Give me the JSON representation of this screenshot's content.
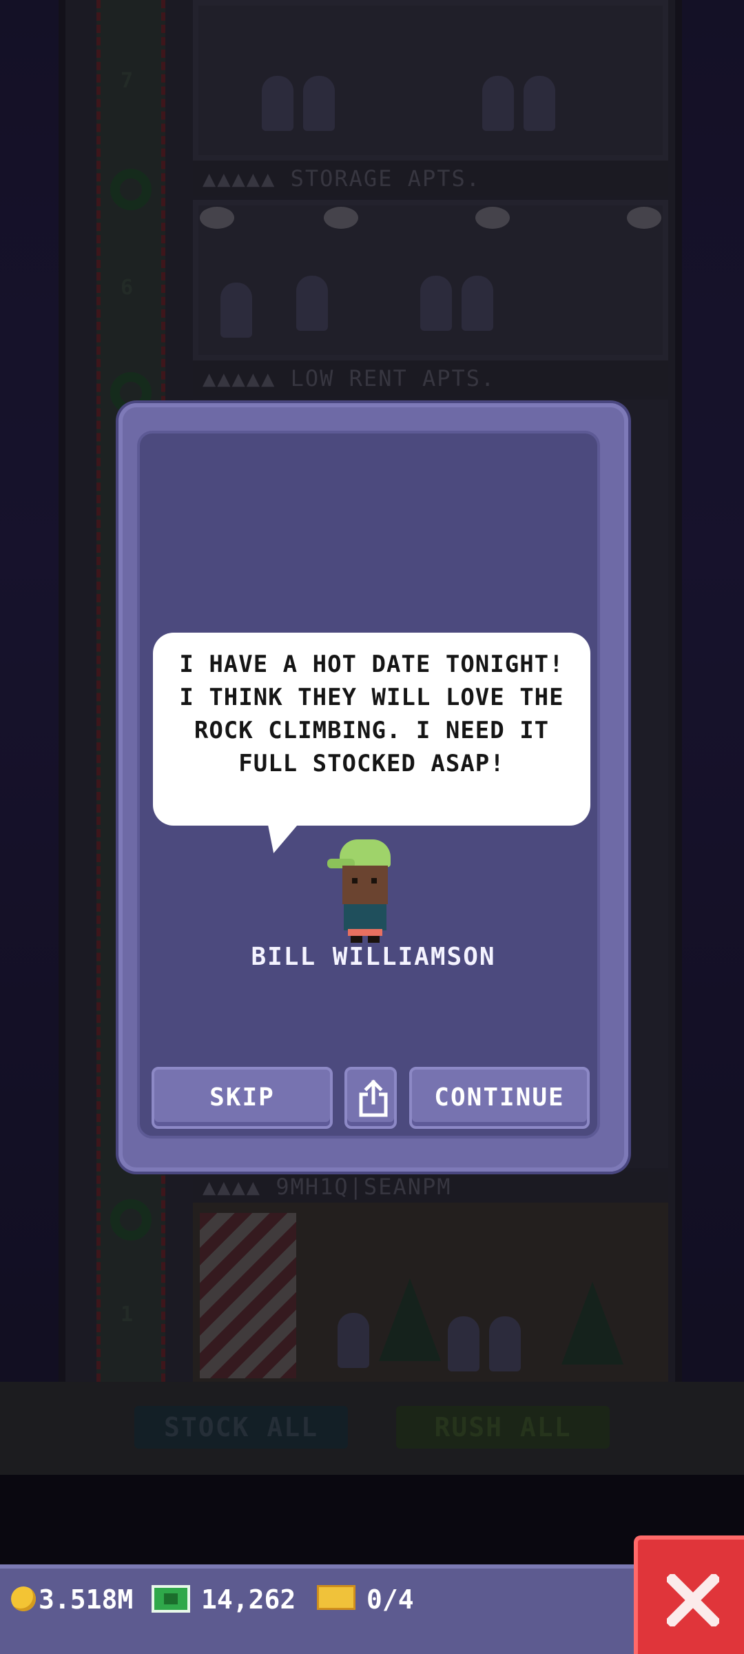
{
  "scene": {
    "floors": [
      {
        "label": "▲▲▲▲▲ STORAGE APTS.",
        "shaft_number": "7"
      },
      {
        "label": "▲▲▲▲▲ LOW RENT APTS.",
        "shaft_number": "6"
      },
      {
        "label": "▲▲▲▲ 9MH1Q|SEANPM",
        "shaft_number": "1"
      }
    ],
    "bottom_buttons": {
      "stock_all": "STOCK ALL",
      "rush_all": "RUSH ALL"
    }
  },
  "dialog": {
    "message": "I HAVE A HOT DATE TONIGHT! I THINK THEY WILL LOVE THE ROCK CLIMBING. I NEED IT FULL STOCKED ASAP!",
    "npc_name": "BILL WILLIAMSON",
    "skip_label": "SKIP",
    "continue_label": "CONTINUE",
    "share_icon": "share-icon"
  },
  "currency": {
    "coins": "3.518M",
    "bux": "14,262",
    "tickets": "0/4"
  },
  "colors": {
    "dialog_bg": "#4c4a7e",
    "button": "#7773b0",
    "close_button": "#e0353a",
    "currency_bar": "#5d5b90"
  }
}
